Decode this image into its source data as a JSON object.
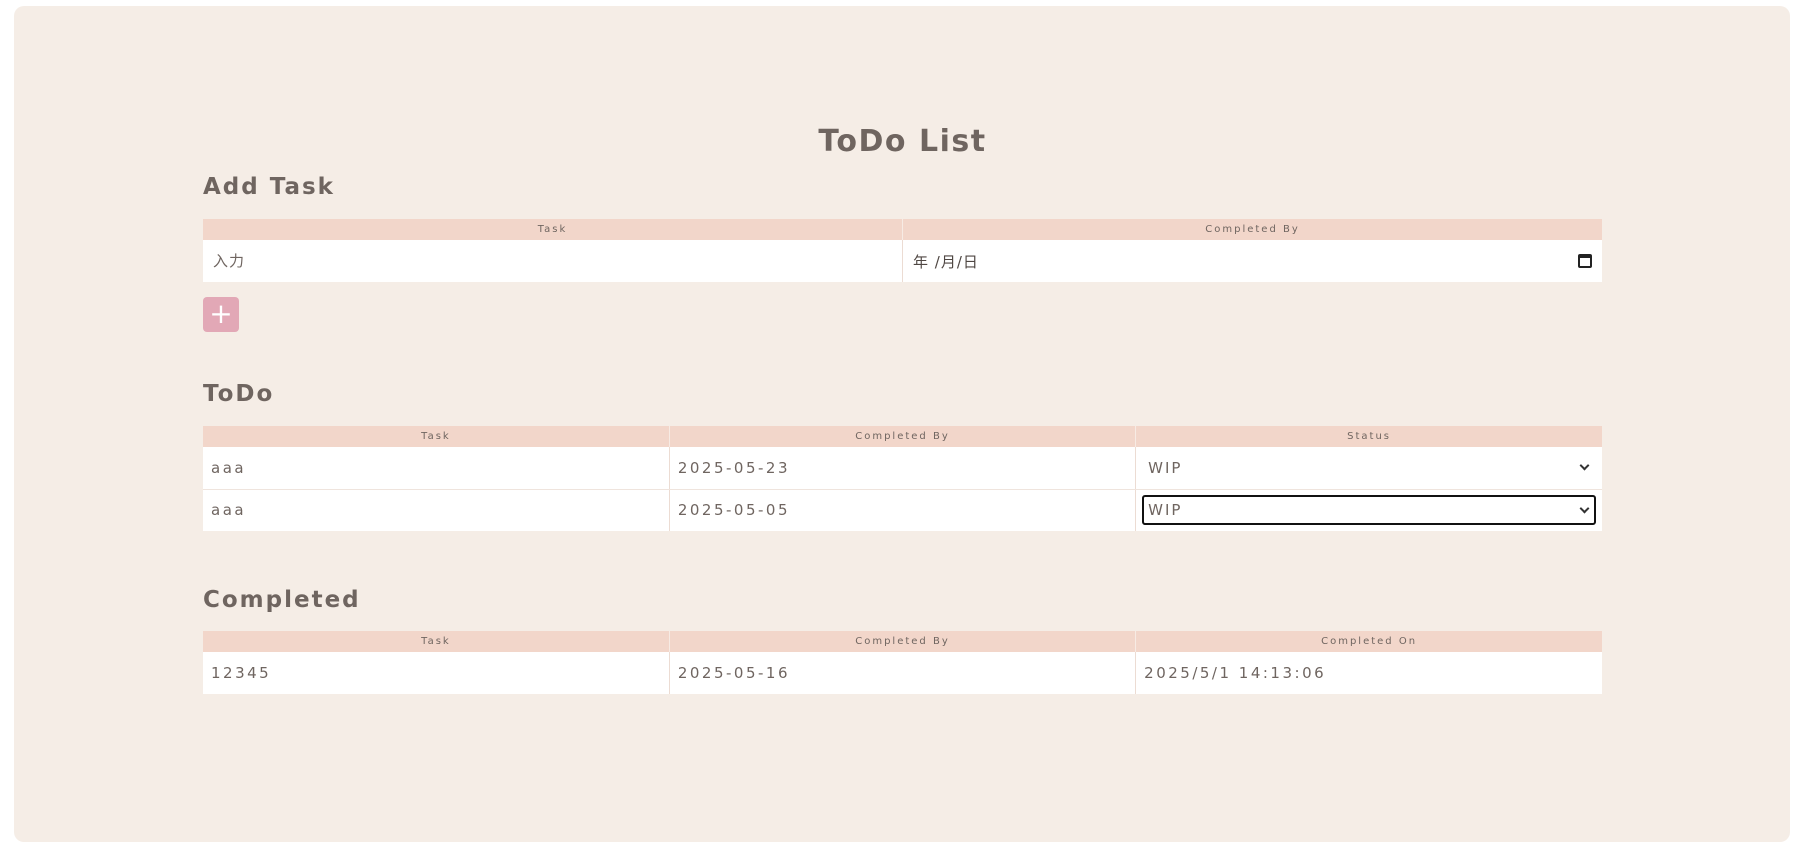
{
  "title": "ToDo List",
  "add_section": {
    "heading": "Add Task",
    "columns": [
      "Task",
      "Completed By"
    ],
    "task_placeholder": "入力",
    "date_placeholder": "年 /月/日",
    "add_button": "+"
  },
  "todo_section": {
    "heading": "ToDo",
    "columns": [
      "Task",
      "Completed By",
      "Status"
    ],
    "rows": [
      {
        "task": "aaa",
        "completed_by": "2025-05-23",
        "status": "WIP"
      },
      {
        "task": "aaa",
        "completed_by": "2025-05-05",
        "status": "WIP"
      }
    ]
  },
  "completed_section": {
    "heading": "Completed",
    "columns": [
      "Task",
      "Completed By",
      "Completed On"
    ],
    "rows": [
      {
        "task": "12345",
        "completed_by": "2025-05-16",
        "completed_on": "2025/5/1 14:13:06"
      }
    ]
  },
  "colors": {
    "background": "#f5ede6",
    "header": "#f2d6ca",
    "accent_button": "#e2a8b6",
    "text": "#6f6560"
  },
  "icons": [
    "calendar-icon",
    "chevron-down-icon",
    "plus-icon"
  ]
}
